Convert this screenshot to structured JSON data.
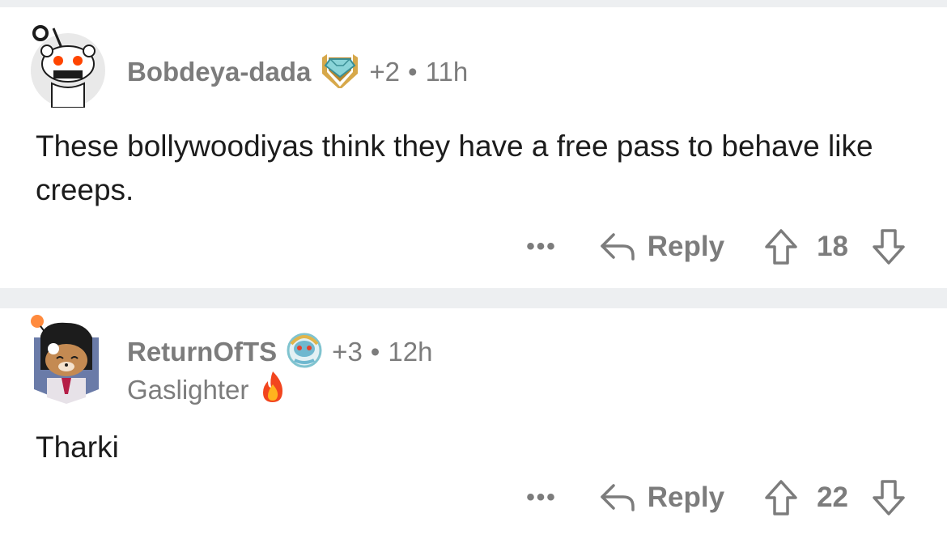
{
  "comments": [
    {
      "username": "Bobdeya-dada",
      "award_icon": "diamond-shield-award-icon",
      "karma_delta": "+2",
      "age": "11h",
      "body": "These bollywoodiyas think they have a free pass to behave like creeps.",
      "more_label": "•••",
      "reply_label": "Reply",
      "score": "18"
    },
    {
      "username": "ReturnOfTS",
      "award_icon": "snoo-helmet-award-icon",
      "karma_delta": "+3",
      "age": "12h",
      "flair": "Gaslighter",
      "flair_icon": "fire-icon",
      "body": "Tharki",
      "more_label": "•••",
      "reply_label": "Reply",
      "score": "22"
    }
  ],
  "colors": {
    "meta_gray": "#7c7c7c",
    "divider": "#edeff1",
    "text": "#1c1c1c"
  }
}
